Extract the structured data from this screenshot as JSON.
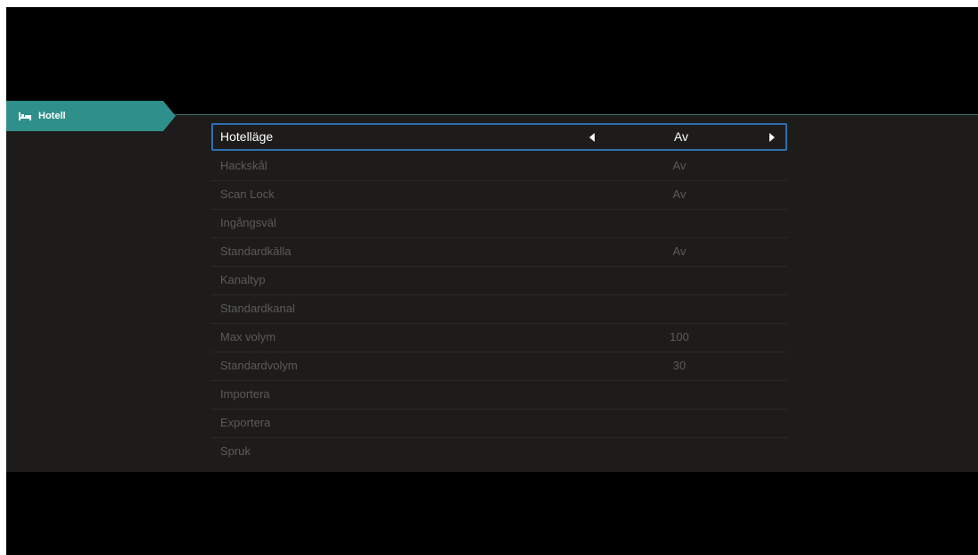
{
  "sidebar": {
    "tab_label": "Hotell",
    "tab_icon": "hotel-icon"
  },
  "menu": {
    "items": [
      {
        "label": "Hotelläge",
        "value": "Av"
      },
      {
        "label": "Hackskål",
        "value": "Av"
      },
      {
        "label": "Scan Lock",
        "value": "Av"
      },
      {
        "label": "Ingångsväl",
        "value": ""
      },
      {
        "label": "Standardkälla",
        "value": "Av"
      },
      {
        "label": "Kanaltyp",
        "value": ""
      },
      {
        "label": "Standardkanal",
        "value": ""
      },
      {
        "label": "Max volym",
        "value": "100"
      },
      {
        "label": "Standardvolym",
        "value": "30"
      },
      {
        "label": "Importera",
        "value": ""
      },
      {
        "label": "Exportera",
        "value": ""
      },
      {
        "label": "Spruk",
        "value": ""
      }
    ]
  },
  "colors": {
    "accent": "#2f8f8b",
    "selection_border": "#2f6fb0",
    "panel_bg": "#1d1c1b"
  }
}
